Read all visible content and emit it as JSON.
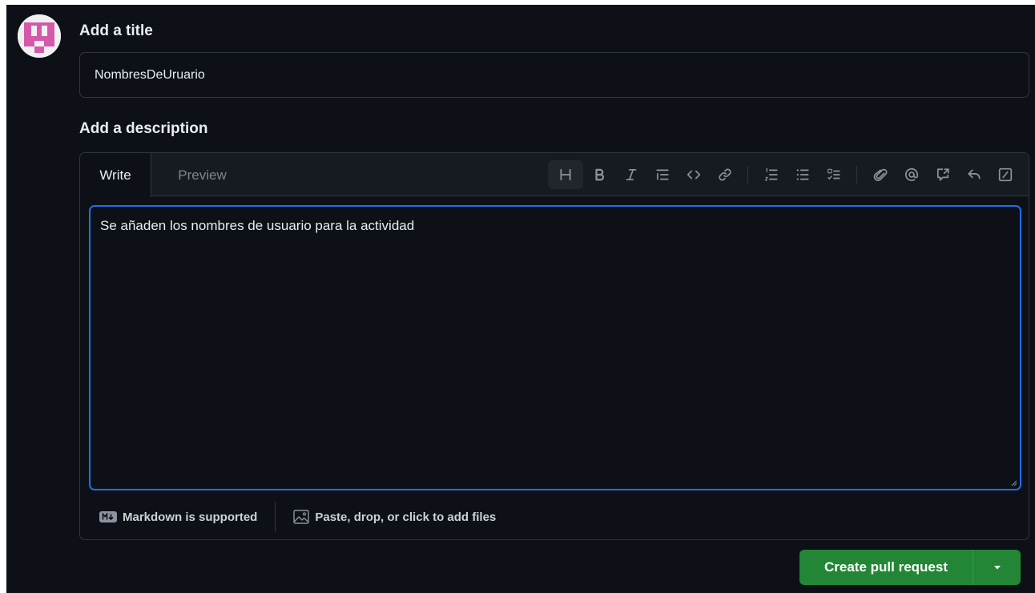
{
  "title_section": {
    "label": "Add a title",
    "value": "NombresDeUruario"
  },
  "description_section": {
    "label": "Add a description",
    "tabs": [
      "Write",
      "Preview"
    ],
    "active_tab": "Write",
    "body_text": "Se añaden los nombres de usuario para la actividad",
    "toolbar_icons": [
      "heading-icon",
      "bold-icon",
      "italic-icon",
      "quote-icon",
      "code-icon",
      "link-icon",
      "numbered-list-icon",
      "unordered-list-icon",
      "task-list-icon",
      "attach-icon",
      "mention-icon",
      "reference-icon",
      "reply-icon",
      "slash-commands-icon"
    ],
    "footer": {
      "markdown": "Markdown is supported",
      "attach": "Paste, drop, or click to add files"
    }
  },
  "actions": {
    "create_label": "Create pull request"
  },
  "colors": {
    "background": "#0d1117",
    "accent": "#1f6feb",
    "primary_button": "#238636",
    "avatar": "#d459ab"
  }
}
